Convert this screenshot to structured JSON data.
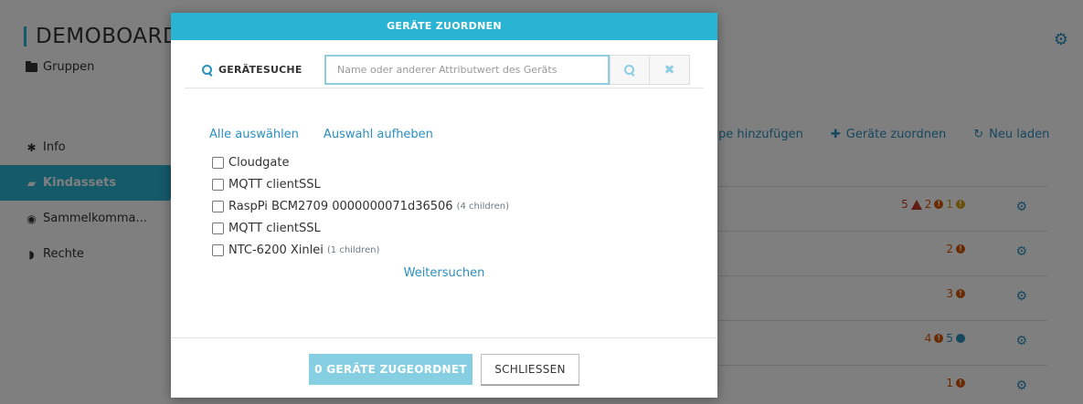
{
  "app": {
    "title": "DEMOBOARD",
    "groups_label": "Gruppen",
    "nav": [
      {
        "label": "Info",
        "icon": "asterisk-icon"
      },
      {
        "label": "Kindassets",
        "icon": "folder-open-icon"
      },
      {
        "label": "Sammelkomma...",
        "icon": "gamepad-icon"
      },
      {
        "label": "Rechte",
        "icon": "shield-icon"
      }
    ],
    "actions": [
      {
        "label": "pe hinzufügen",
        "icon": "none"
      },
      {
        "label": "Geräte zuordnen",
        "icon": "plus-icon"
      },
      {
        "label": "Neu laden",
        "icon": "refresh-icon"
      }
    ],
    "rows": [
      {
        "status": [
          {
            "value": "5",
            "kind": "red-warning"
          },
          {
            "value": "2",
            "kind": "orange"
          },
          {
            "value": "1",
            "kind": "yellow"
          }
        ]
      },
      {
        "status": [
          {
            "value": "2",
            "kind": "orange"
          }
        ]
      },
      {
        "status": [
          {
            "value": "3",
            "kind": "orange"
          }
        ]
      },
      {
        "status": [
          {
            "value": "4",
            "kind": "orange"
          },
          {
            "value": "5",
            "kind": "blue"
          }
        ]
      },
      {
        "status": [
          {
            "value": "1",
            "kind": "orange"
          }
        ]
      }
    ]
  },
  "modal": {
    "title": "GERÄTE ZUORDNEN",
    "search": {
      "label": "GERÄTESUCHE",
      "placeholder": "Name oder anderer Attributwert des Geräts",
      "value": ""
    },
    "select_all": "Alle auswählen",
    "deselect": "Auswahl aufheben",
    "devices": [
      {
        "name": "Cloudgate",
        "children": ""
      },
      {
        "name": "MQTT clientSSL",
        "children": ""
      },
      {
        "name": "RaspPi BCM2709 0000000071d36506",
        "children": "(4 children)"
      },
      {
        "name": "MQTT clientSSL",
        "children": ""
      },
      {
        "name": "NTC-6200 Xinlei",
        "children": "(1 children)"
      }
    ],
    "more": "Weitersuchen",
    "assigned_button": "0 GERÄTE ZUGEORDNET",
    "close_button": "SCHLIESSEN"
  },
  "colors": {
    "accent": "#2ab4d3",
    "link": "#2a8fbf"
  }
}
